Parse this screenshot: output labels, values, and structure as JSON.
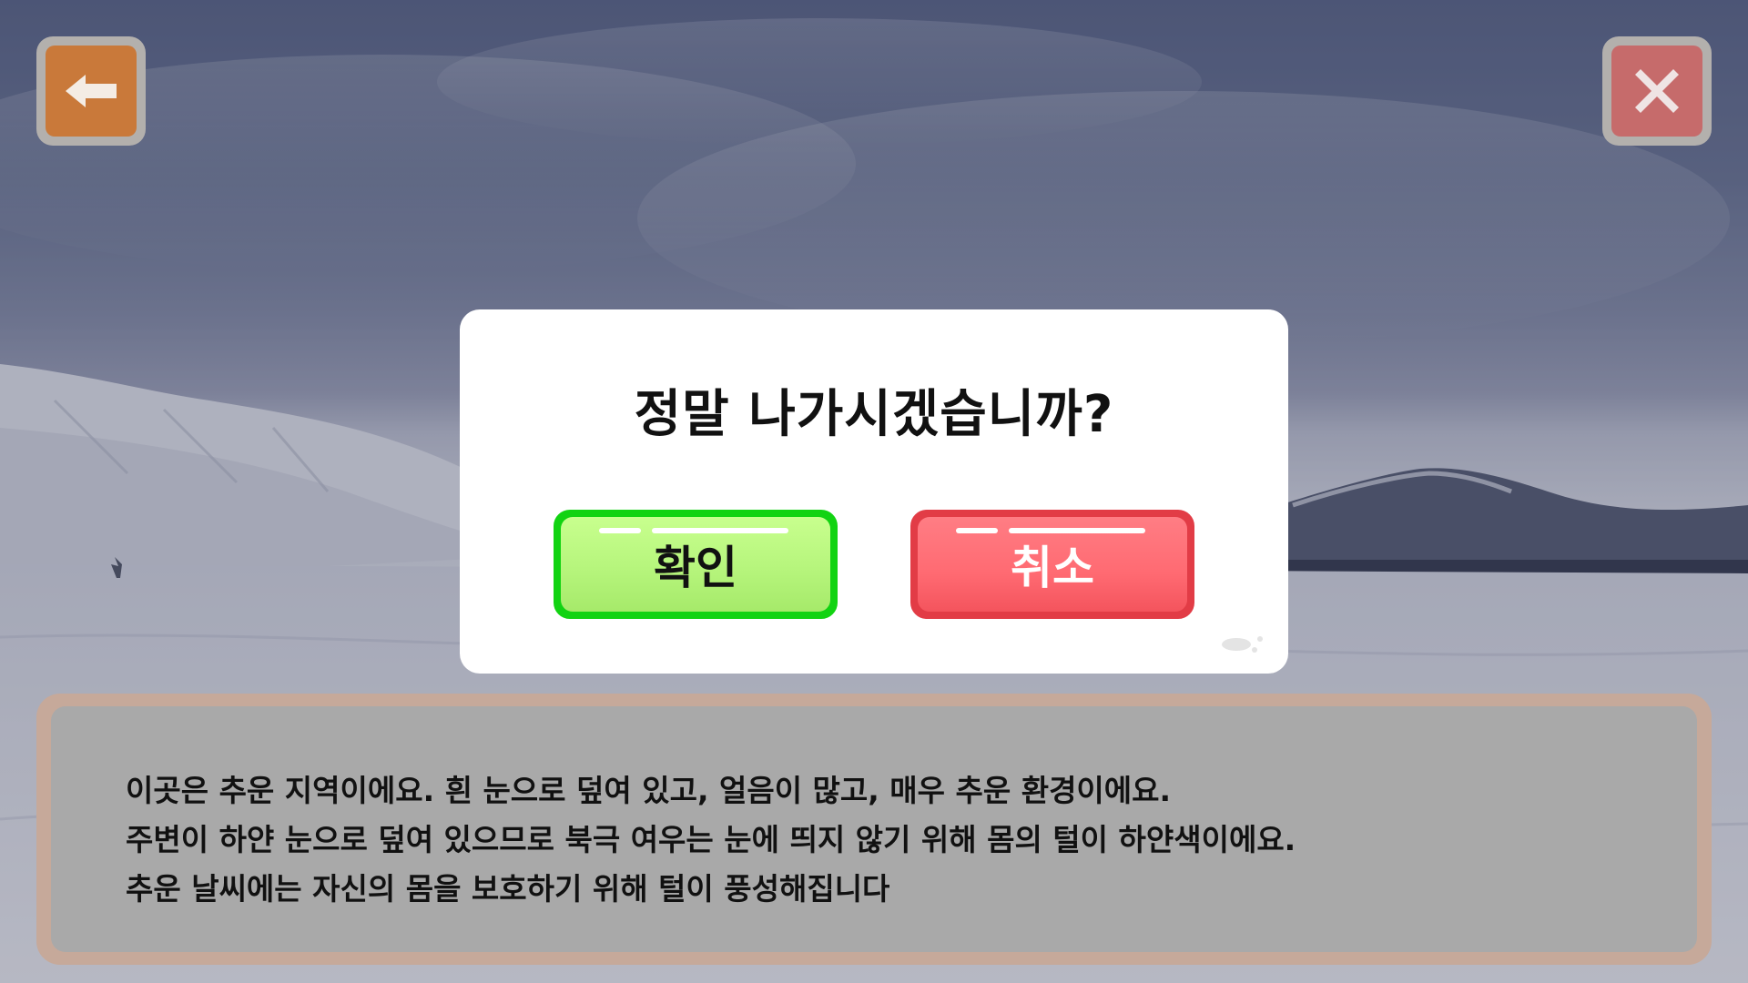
{
  "scene": {
    "background": "snowy winter field with mountains"
  },
  "top_bar": {
    "back_icon": "arrow-left-icon",
    "close_icon": "close-x-icon",
    "back_color": "#c9793a",
    "close_color": "#c66b6b"
  },
  "dialog": {
    "title": "정말 나가시겠습니까?",
    "confirm_label": "확인",
    "cancel_label": "취소",
    "confirm_color": "#b6f57c",
    "cancel_color": "#ff6a72"
  },
  "info": {
    "lines": [
      "이곳은 추운 지역이에요. 흰 눈으로 덮여 있고, 얼음이 많고, 매우 추운 환경이에요.",
      "주변이 하얀 눈으로 덮여 있으므로 북극 여우는 눈에 띄지 않기 위해 몸의 털이 하얀색이에요.",
      "추운 날씨에는 자신의 몸을 보호하기 위해 털이 풍성해집니다"
    ]
  }
}
